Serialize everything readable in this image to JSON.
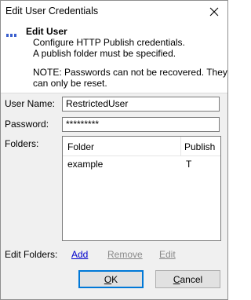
{
  "window": {
    "title": "Edit User Credentials"
  },
  "header": {
    "title": "Edit User",
    "line1": "Configure HTTP Publish credentials.",
    "line2": "A publish folder must be specified.",
    "note1": "NOTE: Passwords can not be recovered. They",
    "note2": "can only be reset."
  },
  "form": {
    "username_label": "User Name:",
    "username_value": "RestrictedUser",
    "password_label": "Password:",
    "password_value": "*********",
    "folders_label": "Folders:"
  },
  "folders_table": {
    "columns": [
      "Folder",
      "Publish"
    ],
    "rows": [
      {
        "folder": "example",
        "publish": "T"
      }
    ]
  },
  "edit_folders": {
    "label": "Edit Folders:",
    "add": "Add",
    "remove": "Remove",
    "edit": "Edit"
  },
  "buttons": {
    "ok_mnemonic": "O",
    "ok_rest": "K",
    "cancel_mnemonic": "C",
    "cancel_rest": "ancel"
  },
  "colors": {
    "link": "#0000cc",
    "disabled_link": "#8a8a8a",
    "focus": "#0078d7"
  }
}
